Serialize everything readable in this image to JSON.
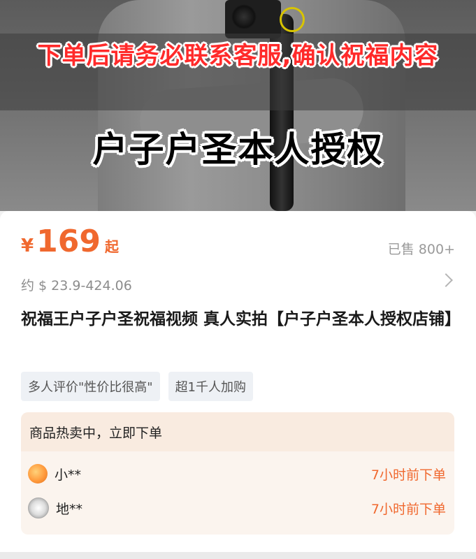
{
  "banner": {
    "top_text": "下单后请务必联系客服,确认祝福内容",
    "middle_text": "户子户圣本人授权"
  },
  "product": {
    "currency_symbol": "¥",
    "price": "169",
    "price_suffix": "起",
    "sold": "已售 800+",
    "approx_price": "约 $ 23.9-424.06",
    "title": "祝福王户子户圣祝福视频 真人实拍【户子户圣本人授权店铺】",
    "tags": [
      "多人评价\"性价比很高\"",
      "超1千人加购"
    ]
  },
  "hot_sale": {
    "heading": "商品热卖中，立即下单",
    "orders": [
      {
        "user": "小**",
        "time": "7小时前下单"
      },
      {
        "user": "地**",
        "time": "7小时前下单"
      }
    ]
  },
  "colors": {
    "accent": "#f0682e",
    "banner_red": "#ff2a2a"
  },
  "icons": {
    "chevron": "chevron-right-icon"
  }
}
